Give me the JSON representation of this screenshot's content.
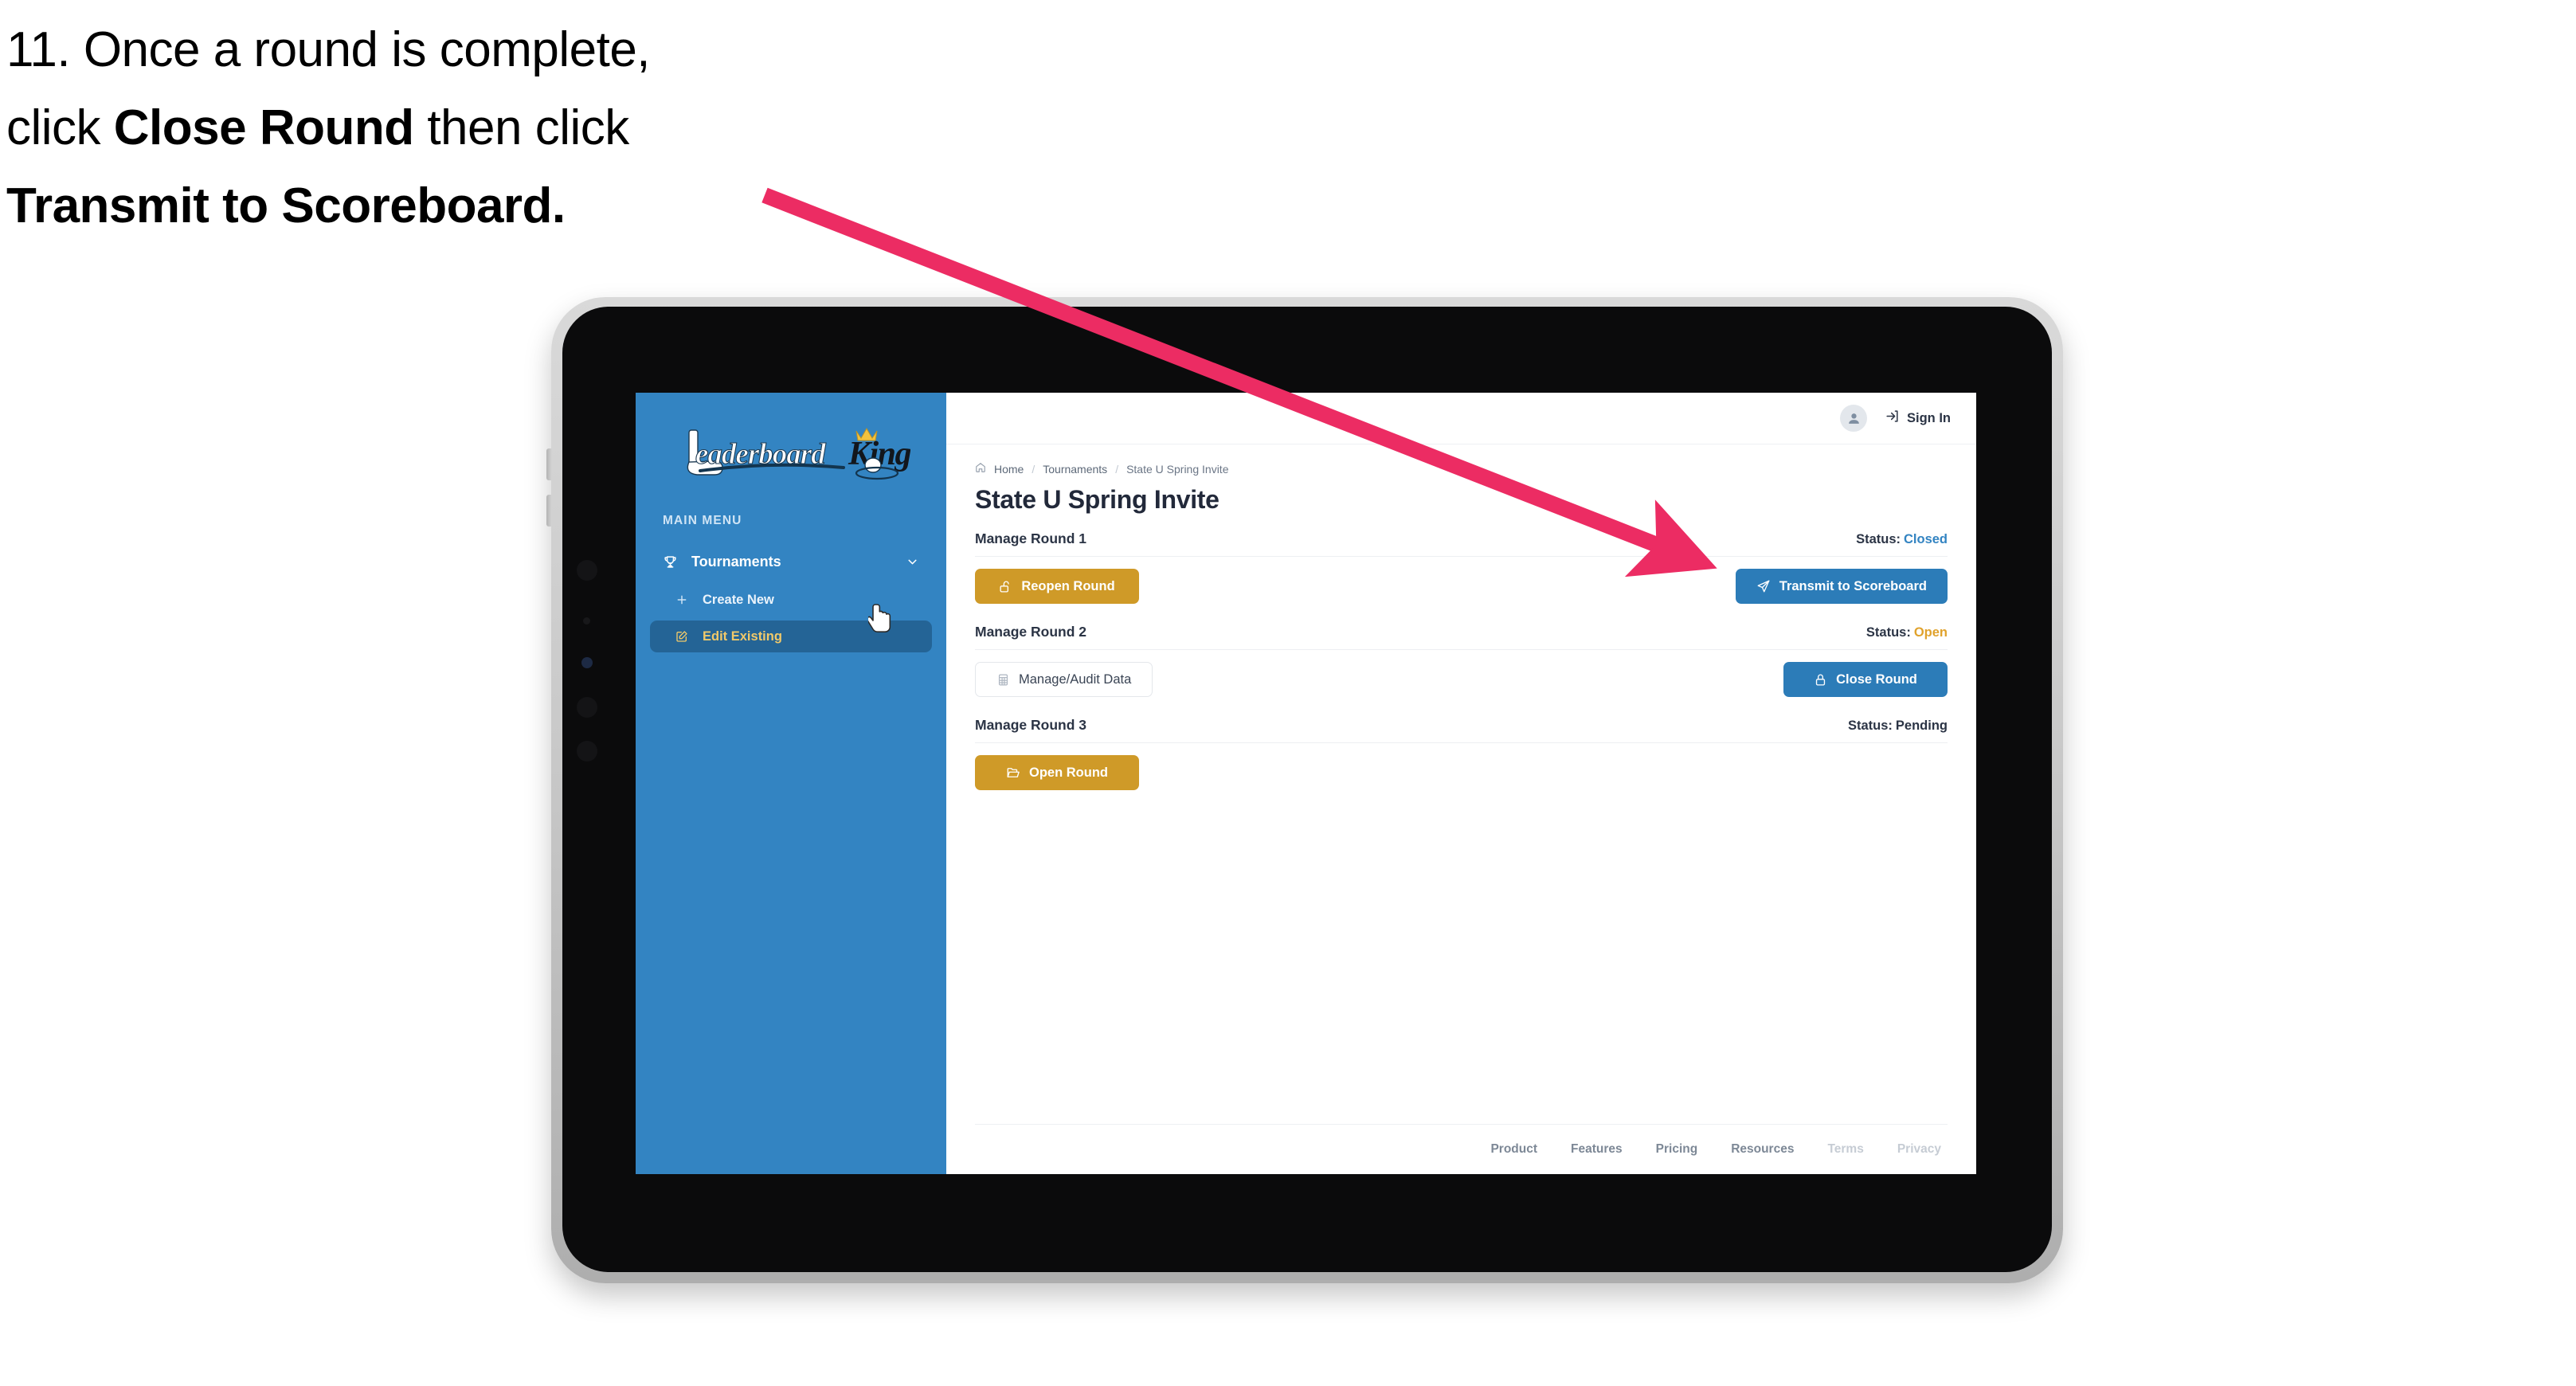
{
  "caption": {
    "line1": "11. Once a round is complete,",
    "line2_pre": "click ",
    "line2_bold": "Close Round",
    "line2_post": " then click",
    "line3_bold": "Transmit to Scoreboard."
  },
  "annotation": {
    "arrow_color": "#ec2c63",
    "arrow_start": "960,245",
    "arrow_end": "2122,700"
  },
  "app": {
    "sidebar": {
      "logo_text_left": "Leaderboard",
      "logo_text_right": "King",
      "section_label": "MAIN MENU",
      "items": [
        {
          "label": "Tournaments",
          "icon": "trophy-icon",
          "chevron": "chevron-down-icon",
          "active": false
        },
        {
          "label": "Create New",
          "icon": "plus-icon",
          "active": false
        },
        {
          "label": "Edit Existing",
          "icon": "edit-pencil-icon",
          "active": true
        }
      ],
      "bg_color": "#3384c2",
      "active_bg_color": "#246496",
      "active_text_color": "#f0c96a"
    },
    "topbar": {
      "avatar_icon": "user-avatar-icon",
      "signin_icon": "login-arrow-icon",
      "signin_label": "Sign In"
    },
    "breadcrumb": {
      "home_icon": "home-icon",
      "items": [
        "Home",
        "Tournaments",
        "State U Spring Invite"
      ],
      "separator": "/"
    },
    "page_title": "State U Spring Invite",
    "rounds": [
      {
        "name": "Manage Round 1",
        "status_label": "Status:",
        "status_value": "Closed",
        "status_kind": "closed",
        "left_button": {
          "label": "Reopen Round",
          "icon": "unlock-icon",
          "style": "gold"
        },
        "right_button": {
          "label": "Transmit to Scoreboard",
          "icon": "paper-plane-icon",
          "style": "blue"
        }
      },
      {
        "name": "Manage Round 2",
        "status_label": "Status:",
        "status_value": "Open",
        "status_kind": "open",
        "left_button": {
          "label": "Manage/Audit Data",
          "icon": "table-grid-icon",
          "style": "ghost"
        },
        "right_button": {
          "label": "Close Round",
          "icon": "lock-icon",
          "style": "blue"
        }
      },
      {
        "name": "Manage Round 3",
        "status_label": "Status:",
        "status_value": "Pending",
        "status_kind": "pending",
        "left_button": {
          "label": "Open Round",
          "icon": "open-folder-icon",
          "style": "gold"
        },
        "right_button": null
      }
    ],
    "footer": {
      "links": [
        {
          "label": "Product",
          "muted": false
        },
        {
          "label": "Features",
          "muted": false
        },
        {
          "label": "Pricing",
          "muted": false
        },
        {
          "label": "Resources",
          "muted": false
        },
        {
          "label": "Terms",
          "muted": true
        },
        {
          "label": "Privacy",
          "muted": true
        }
      ]
    },
    "colors": {
      "brand_blue": "#3384c2",
      "button_blue": "#2c7cb8",
      "button_gold": "#cf9a28",
      "status_open": "#e0a22c",
      "text_dark": "#2b3445"
    }
  }
}
